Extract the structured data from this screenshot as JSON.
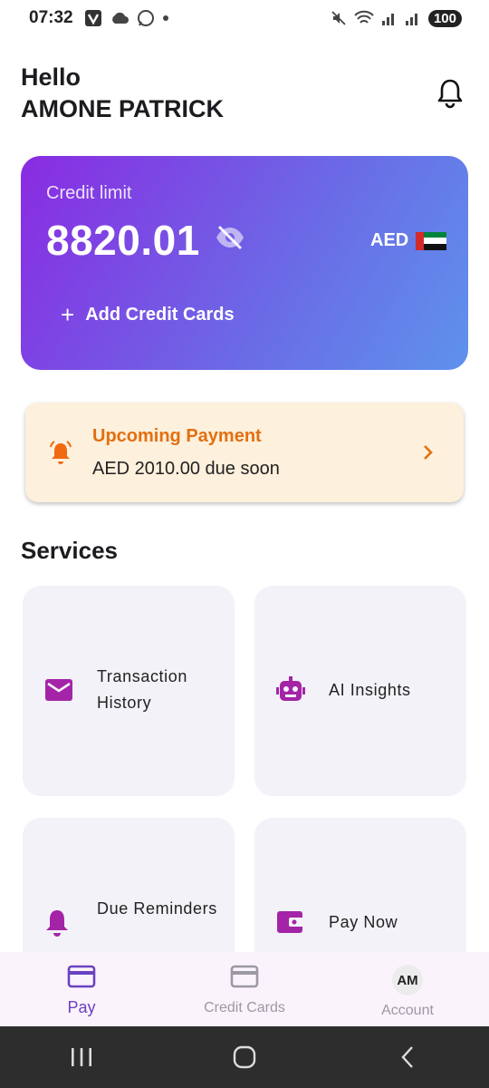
{
  "status_bar": {
    "time": "07:32",
    "battery": "100"
  },
  "header": {
    "greeting": "Hello",
    "user_name": "AMONE PATRICK"
  },
  "credit_card": {
    "label": "Credit limit",
    "amount": "8820.01",
    "currency": "AED",
    "add_button_label": "Add Credit Cards"
  },
  "upcoming_payment": {
    "title": "Upcoming Payment",
    "subtitle": "AED 2010.00 due soon"
  },
  "services": {
    "title": "Services",
    "items": [
      {
        "label": "Transaction History",
        "icon": "mail-icon"
      },
      {
        "label": "AI Insights",
        "icon": "robot-icon"
      },
      {
        "label": "Due Reminders",
        "icon": "bell-icon"
      },
      {
        "label": "Pay Now",
        "icon": "wallet-icon"
      }
    ]
  },
  "bottom_nav": {
    "items": [
      {
        "label": "Pay",
        "icon": "credit-card-icon",
        "active": true
      },
      {
        "label": "Credit Cards",
        "icon": "credit-card-icon",
        "active": false
      },
      {
        "label": "Account",
        "icon": "avatar",
        "initials": "AM",
        "active": false
      }
    ]
  },
  "colors": {
    "accent_purple": "#8a2be2",
    "accent_blue": "#5e92ec",
    "icon_purple": "#a424a8",
    "warning_orange": "#e36f10",
    "nav_active": "#6a42c2"
  }
}
